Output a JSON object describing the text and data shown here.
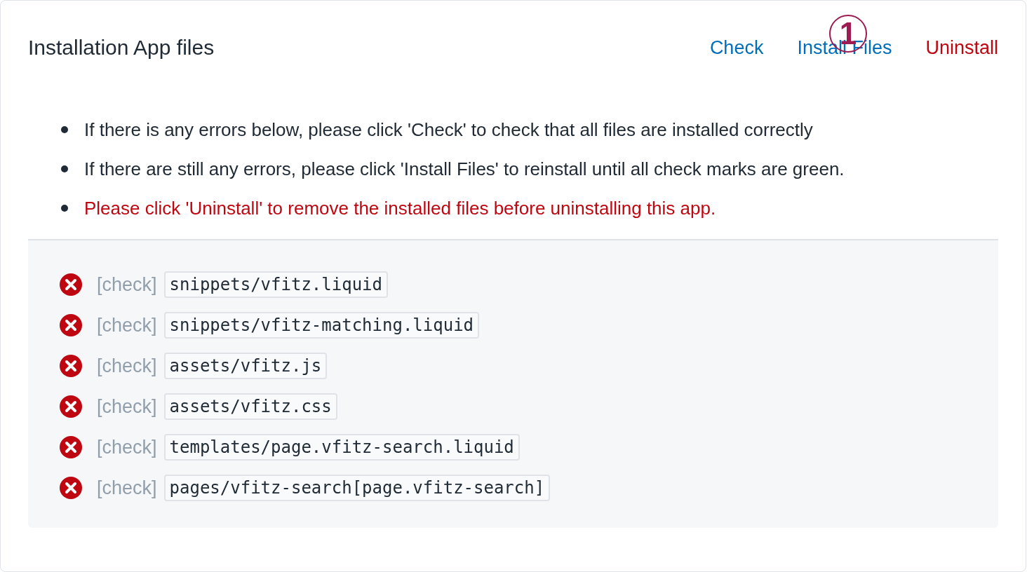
{
  "header": {
    "title": "Installation App files",
    "actions": [
      {
        "label": "Check",
        "kind": "normal"
      },
      {
        "label": "Install Files",
        "kind": "normal"
      },
      {
        "label": "Uninstall",
        "kind": "danger"
      }
    ]
  },
  "annotation": {
    "label": "1"
  },
  "notes": [
    {
      "text": "If there is any errors below, please click 'Check' to check that all files are installed correctly",
      "kind": "normal"
    },
    {
      "text": "If there are still any errors, please click 'Install Files' to reinstall until all check marks are green.",
      "kind": "normal"
    },
    {
      "text": "Please click 'Uninstall' to remove the installed files before uninstalling this app.",
      "kind": "warning"
    }
  ],
  "files": [
    {
      "ok": false,
      "tag": "[check]",
      "path": "snippets/vfitz.liquid"
    },
    {
      "ok": false,
      "tag": "[check]",
      "path": "snippets/vfitz-matching.liquid"
    },
    {
      "ok": false,
      "tag": "[check]",
      "path": "assets/vfitz.js"
    },
    {
      "ok": false,
      "tag": "[check]",
      "path": "assets/vfitz.css"
    },
    {
      "ok": false,
      "tag": "[check]",
      "path": "templates/page.vfitz-search.liquid"
    },
    {
      "ok": false,
      "tag": "[check]",
      "path": "pages/vfitz-search[page.vfitz-search]"
    }
  ]
}
